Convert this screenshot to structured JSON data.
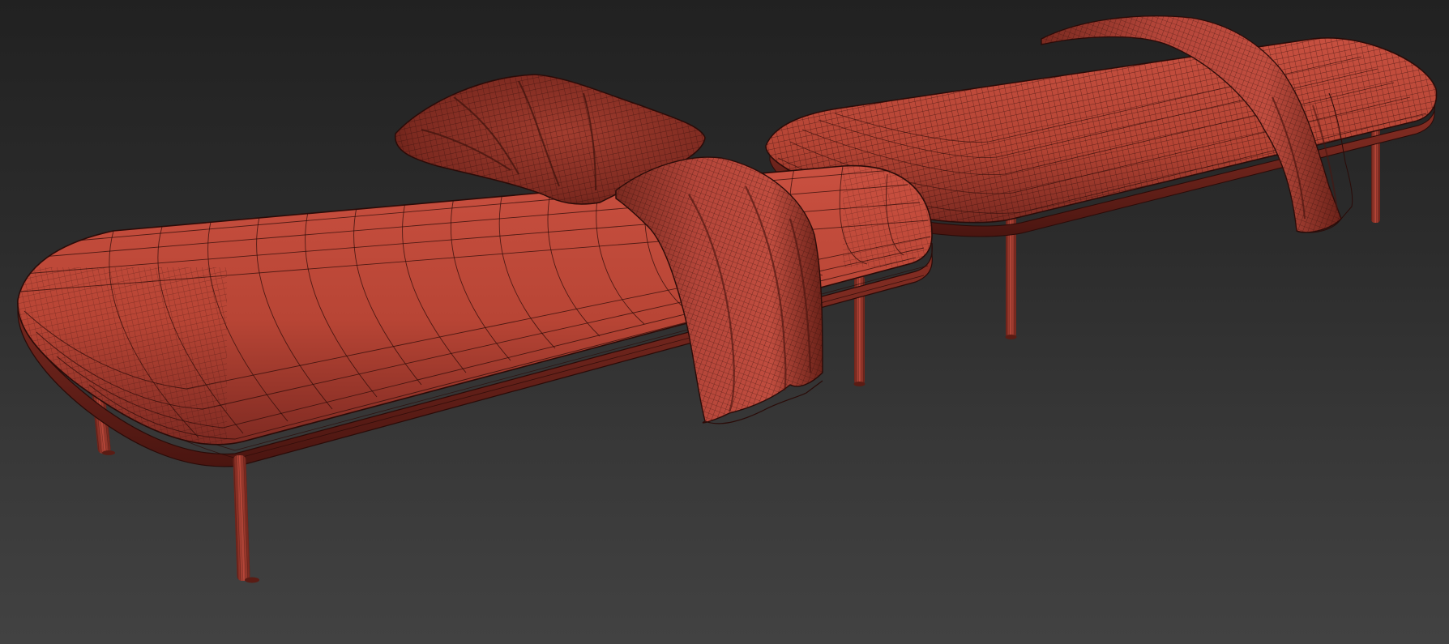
{
  "viewport": {
    "background_top": "#212121",
    "background_bottom": "#424242"
  },
  "scene": {
    "objects": [
      {
        "name": "daybed-left",
        "has_pillow": true,
        "has_throw": true,
        "legs_visible": 4
      },
      {
        "name": "daybed-right",
        "has_pillow": false,
        "has_throw": true,
        "legs_visible": 3
      }
    ],
    "materials": {
      "cushion": "#c44a3c",
      "cushion_shade": "#7e2a22",
      "wire": "#2a0b08",
      "leg": "#a8402f",
      "pillow": "#8f3528",
      "throw": "#b5463a"
    },
    "display_mode": "shaded-wireframe"
  }
}
